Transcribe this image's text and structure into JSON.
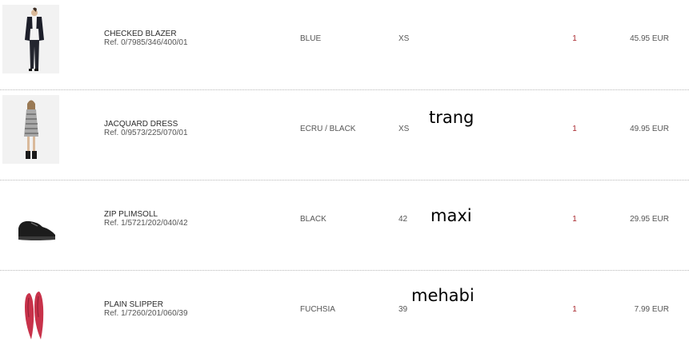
{
  "items": [
    {
      "image_icon": "checked-blazer-photo",
      "name": "CHECKED BLAZER",
      "ref": "Ref. 0/7985/346/400/01",
      "color": "BLUE",
      "size": "XS",
      "quantity": "1",
      "price": "45.95 EUR"
    },
    {
      "image_icon": "jacquard-dress-photo",
      "name": "JACQUARD DRESS",
      "ref": "Ref. 0/9573/225/070/01",
      "color": "ECRU / BLACK",
      "size": "XS",
      "quantity": "1",
      "price": "49.95 EUR"
    },
    {
      "image_icon": "zip-plimsoll-photo",
      "name": "ZIP PLIMSOLL",
      "ref": "Ref. 1/5721/202/040/42",
      "color": "BLACK",
      "size": "42",
      "quantity": "1",
      "price": "29.95 EUR"
    },
    {
      "image_icon": "plain-slipper-photo",
      "name": "PLAIN SLIPPER",
      "ref": "Ref. 1/7260/201/060/39",
      "color": "FUCHSIA",
      "size": "39",
      "quantity": "1",
      "price": "7.99 EUR"
    }
  ],
  "handwritten_notes": [
    "trang",
    "maxi",
    "mehabi"
  ],
  "colors": {
    "quantity_text": "#a8262c",
    "divider": "#b8b8b8",
    "slipper": "#c8324a"
  }
}
